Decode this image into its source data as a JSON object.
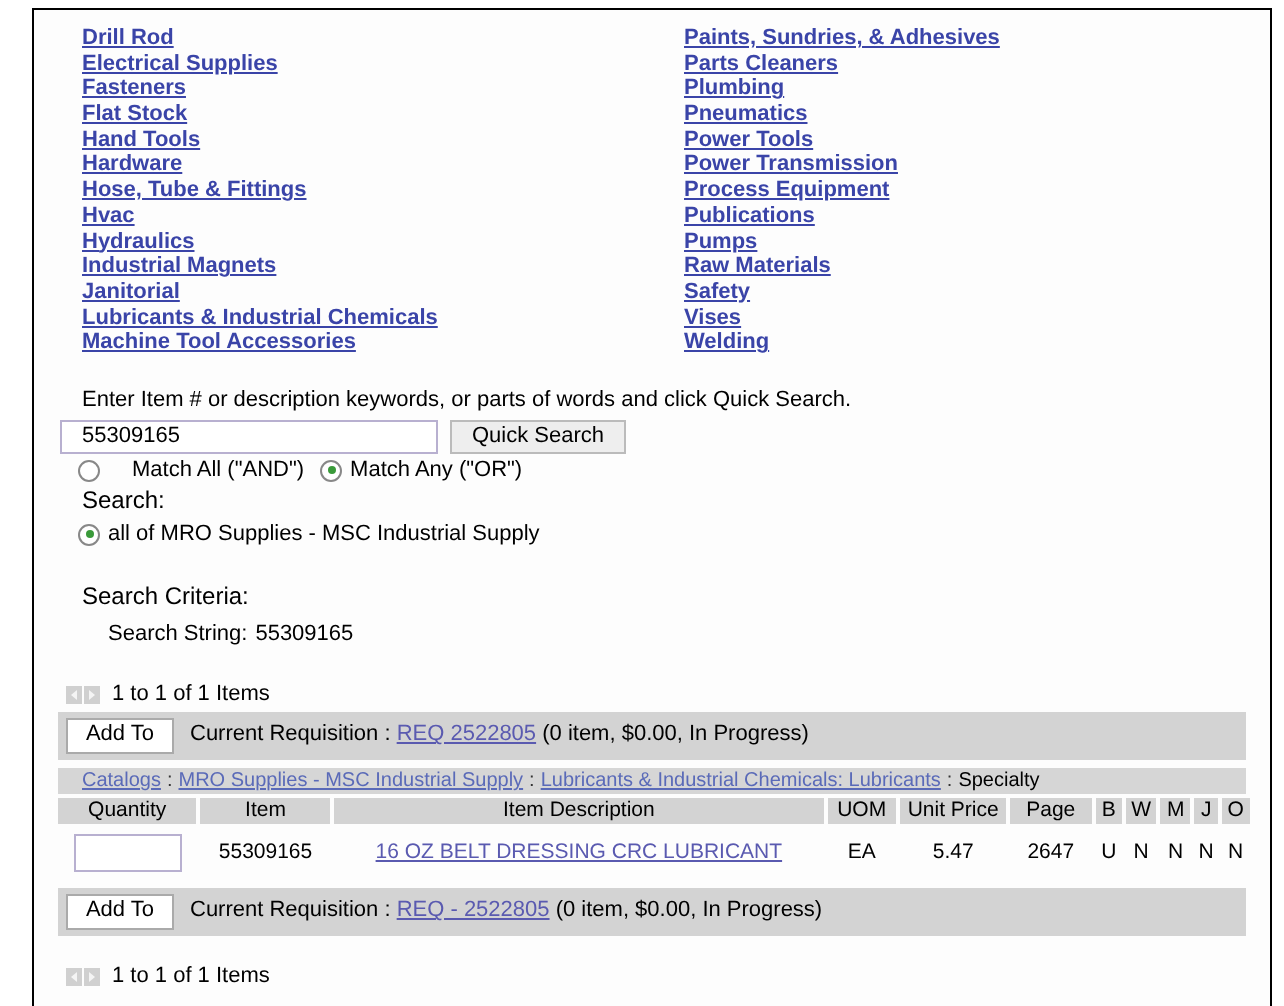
{
  "categories": {
    "column_1": [
      "Drill Rod",
      "Electrical Supplies",
      "Fasteners",
      "Flat Stock",
      "Hand Tools",
      "Hardware",
      "Hose, Tube & Fittings",
      "Hvac",
      "Hydraulics",
      "Industrial Magnets",
      "Janitorial",
      "Lubricants & Industrial Chemicals",
      "Machine Tool Accessories"
    ],
    "column_2": [
      "Paints, Sundries, & Adhesives",
      "Parts Cleaners",
      "Plumbing",
      "Pneumatics",
      "Power Tools",
      "Power Transmission",
      "Process Equipment",
      "Publications",
      "Pumps",
      "Raw Materials",
      "Safety",
      "Vises",
      "Welding"
    ]
  },
  "quick_search": {
    "instructions": "Enter Item # or description keywords, or parts of words and click Quick Search.",
    "value": "55309165",
    "button": "Quick Search",
    "match_options": [
      {
        "label": "Match All (\"AND\")",
        "selected": false
      },
      {
        "label": "Match Any (\"OR\")",
        "selected": true
      }
    ],
    "scope_label": "Search:",
    "scope_options": [
      {
        "label": "all of MRO Supplies - MSC Industrial Supply",
        "selected": true
      }
    ]
  },
  "search_criteria": {
    "title": "Search Criteria:",
    "label": "Search String:",
    "value": "55309165"
  },
  "pager_top": "1 to 1 of 1 Items",
  "requisition_top": {
    "button": "Add To",
    "label": "Current Requisition :",
    "link": "REQ 2522805",
    "summary": "(0 item, $0.00, In Progress)"
  },
  "breadcrumb": [
    {
      "kind": "link",
      "text": "Catalogs"
    },
    {
      "kind": "separator",
      "text": ":"
    },
    {
      "kind": "link",
      "text": "MRO Supplies - MSC Industrial Supply"
    },
    {
      "kind": "separator",
      "text": ":"
    },
    {
      "kind": "link",
      "text": "Lubricants & Industrial Chemicals: Lubricants"
    },
    {
      "kind": "separator",
      "text": ":"
    },
    {
      "kind": "text",
      "text": "Specialty"
    }
  ],
  "table": {
    "columns": [
      "Quantity",
      "Item",
      "Item Description",
      "UOM",
      "Unit Price",
      "Page",
      "B",
      "W",
      "M",
      "J",
      "O"
    ],
    "rows": [
      {
        "item": "55309165",
        "description": "16 OZ BELT DRESSING CRC LUBRICANT",
        "uom": "EA",
        "unit_price": "5.47",
        "page": "2647",
        "flags": [
          "U",
          "N",
          "N",
          "N",
          "N"
        ]
      }
    ]
  },
  "requisition_bottom": {
    "button": "Add To",
    "label": "Current Requisition :",
    "link": "REQ - 2522805",
    "summary": "(0 item, $0.00, In Progress)"
  },
  "pager_bottom": "1 to 1 of 1 Items"
}
